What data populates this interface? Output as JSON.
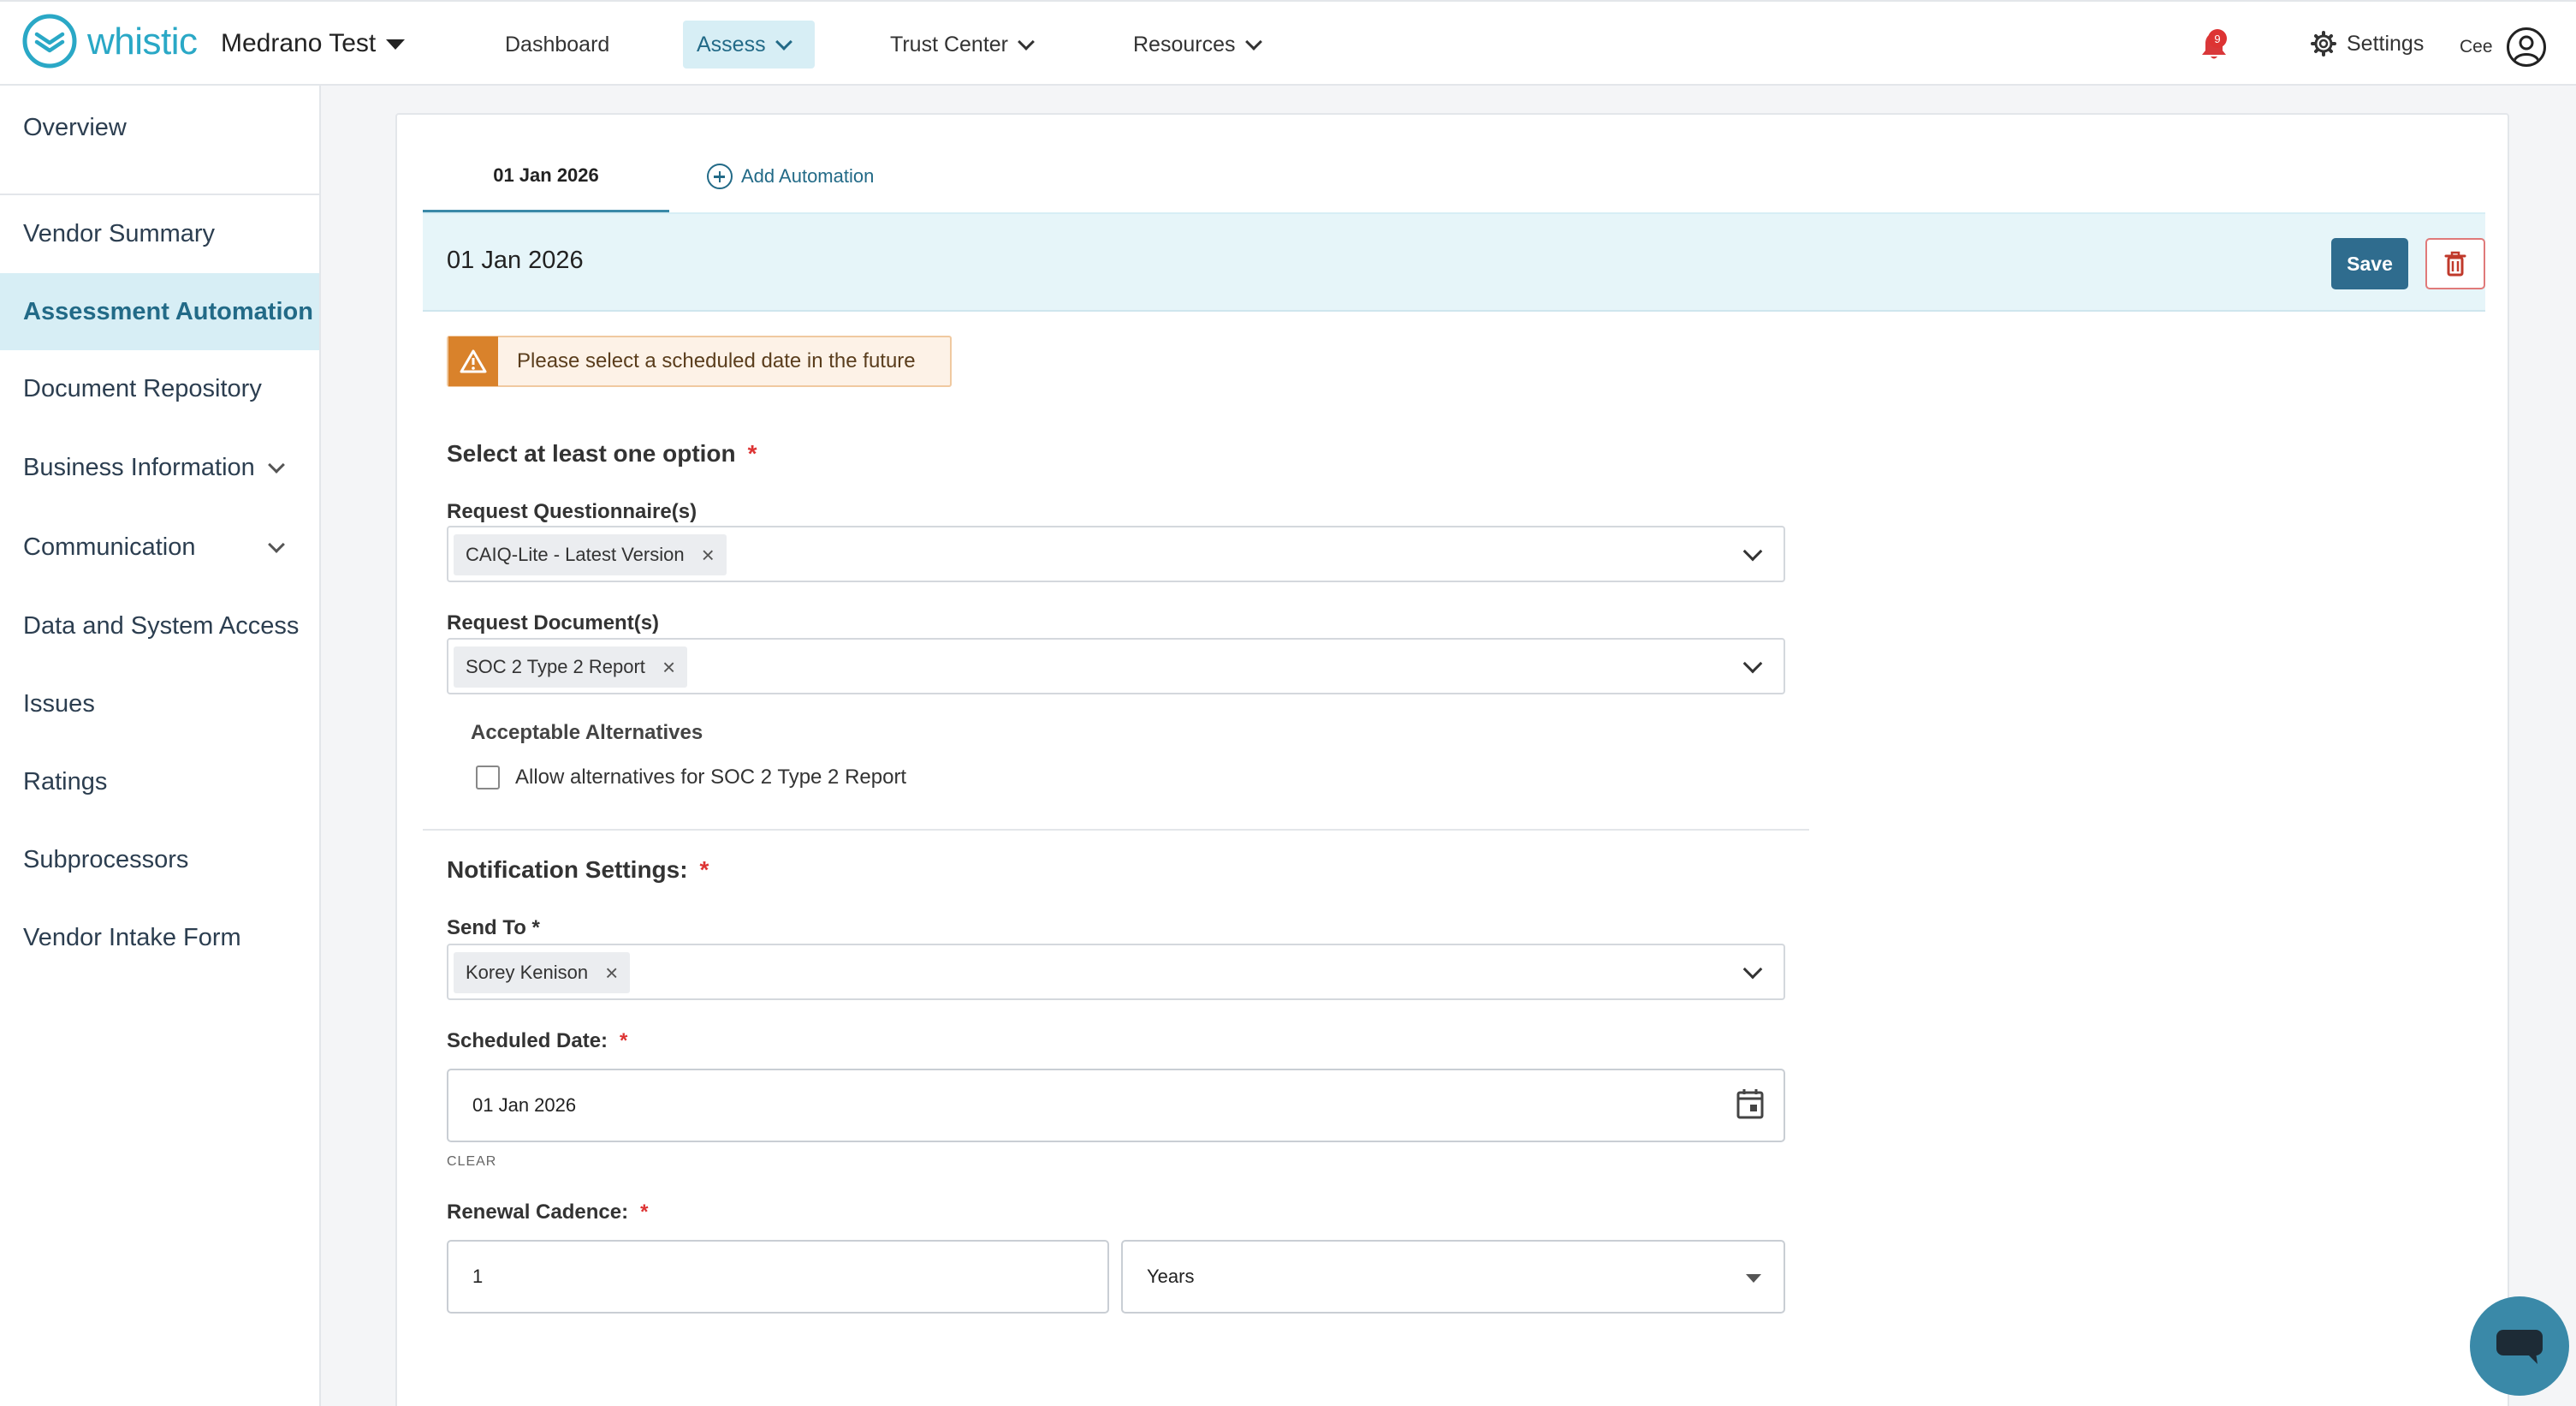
{
  "header": {
    "brand": "whistic",
    "company": "Medrano Test",
    "nav": [
      {
        "label": "Dashboard"
      },
      {
        "label": "Assess"
      },
      {
        "label": "Trust Center"
      },
      {
        "label": "Resources"
      }
    ],
    "notification_count": "9",
    "settings_label": "Settings",
    "user_label": "Cee",
    "active_nav": "Assess"
  },
  "sidebar": {
    "items": [
      {
        "label": "Overview"
      },
      {
        "label": "Vendor Summary"
      },
      {
        "label": "Assessment Automation"
      },
      {
        "label": "Document Repository"
      },
      {
        "label": "Business Information"
      },
      {
        "label": "Communication"
      },
      {
        "label": "Data and System Access"
      },
      {
        "label": "Issues"
      },
      {
        "label": "Ratings"
      },
      {
        "label": "Subprocessors"
      },
      {
        "label": "Vendor Intake Form"
      }
    ],
    "active": "Assessment Automation"
  },
  "tabs": {
    "active_label": "01 Jan 2026",
    "add_label": "Add Automation"
  },
  "panel": {
    "title": "01 Jan 2026",
    "save_label": "Save",
    "warning": "Please select a scheduled date in the future",
    "options_heading": "Select at least one option",
    "required_mark": "*",
    "questionnaire_label": "Request Questionnaire(s)",
    "questionnaire_chip": "CAIQ-Lite - Latest Version",
    "document_label": "Request Document(s)",
    "document_chip": "SOC 2 Type 2 Report",
    "alternatives_heading": "Acceptable Alternatives",
    "alternatives_checkbox": "Allow alternatives for SOC 2 Type 2 Report",
    "notification_heading": "Notification Settings:",
    "send_to_label": "Send To *",
    "send_to_chip": "Korey Kenison",
    "scheduled_label": "Scheduled Date:",
    "scheduled_value": "01 Jan 2026",
    "clear_label": "CLEAR",
    "renewal_label": "Renewal Cadence:",
    "renewal_number": "1",
    "renewal_unit": "Years"
  },
  "colors": {
    "brand": "#2aa8c6",
    "active_bg": "#d7eef5",
    "save_button": "#2f6c8e",
    "warning": "#d9822b",
    "required": "#dd3333",
    "chat_bubble": "#3a89a8"
  },
  "icons": [
    "whistic-logo-icon",
    "caret-down-icon",
    "chevron-down-icon",
    "bell-icon",
    "gear-icon",
    "user-avatar-icon",
    "plus-circle-icon",
    "trash-icon",
    "warning-icon",
    "close-icon",
    "calendar-icon",
    "chat-icon"
  ]
}
